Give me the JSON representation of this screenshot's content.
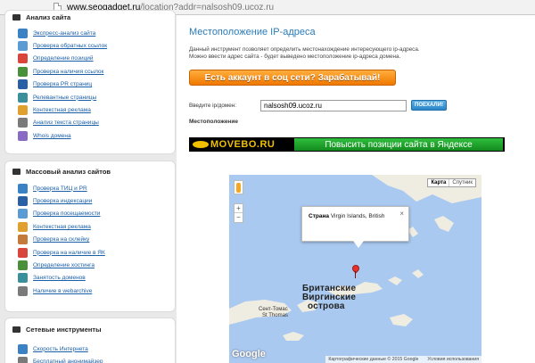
{
  "browser": {
    "url_host": "www.seogadget.ru",
    "url_path": "/location?addr=nalsosh09.ucoz.ru"
  },
  "sidebar": {
    "box1": {
      "title": "Анализ сайта",
      "items": [
        {
          "label": "Экспресс-анализ сайта",
          "icon": "globe-icon",
          "color": "#3b82c4"
        },
        {
          "label": "Проверка обратных ссылок",
          "icon": "links-icon",
          "color": "#5a9bd4"
        },
        {
          "label": "Определение позиций",
          "icon": "positions-icon",
          "color": "#d9443b"
        },
        {
          "label": "Проверка наличия ссылок",
          "icon": "check-links-icon",
          "color": "#4a8f3a"
        },
        {
          "label": "Проверка PR страниц",
          "icon": "pr-icon",
          "color": "#2b5fa3"
        },
        {
          "label": "Релевантные страницы",
          "icon": "relevant-icon",
          "color": "#3b8f9a"
        },
        {
          "label": "Контекстная реклама",
          "icon": "ads-icon",
          "color": "#e0a030"
        },
        {
          "label": "Анализ текста страницы",
          "icon": "text-icon",
          "color": "#7a7a7a"
        },
        {
          "label": "Whois домена",
          "icon": "whois-icon",
          "color": "#8a6bc4"
        }
      ]
    },
    "box2": {
      "title": "Массовый анализ сайтов",
      "items": [
        {
          "label": "Проверка ТИЦ и PR",
          "icon": "tic-pr-icon",
          "color": "#3b82c4"
        },
        {
          "label": "Проверка индексации",
          "icon": "index-icon",
          "color": "#2b5fa3"
        },
        {
          "label": "Проверка посещаемости",
          "icon": "traffic-icon",
          "color": "#5a9bd4"
        },
        {
          "label": "Контекстная реклама",
          "icon": "ads-icon",
          "color": "#e0a030"
        },
        {
          "label": "Проверка на склейку",
          "icon": "glue-icon",
          "color": "#c47a3b"
        },
        {
          "label": "Проверка на наличие в ЯК",
          "icon": "yandex-icon",
          "color": "#d9443b"
        },
        {
          "label": "Определение хостинга",
          "icon": "hosting-icon",
          "color": "#4a8f3a"
        },
        {
          "label": "Занятость доменов",
          "icon": "domains-icon",
          "color": "#3b8f9a"
        },
        {
          "label": "Наличие в webarchive",
          "icon": "archive-icon",
          "color": "#7a7a7a"
        }
      ]
    },
    "box3": {
      "title": "Сетевые инструменты",
      "items": [
        {
          "label": "Скорость Интернета",
          "icon": "speed-icon",
          "color": "#3b82c4"
        },
        {
          "label": "Бесплатный анонимайзер",
          "icon": "anonymizer-icon",
          "color": "#7a7a7a"
        }
      ]
    }
  },
  "main": {
    "title": "Местоположение IP-адреса",
    "desc1": "Данный инструмент позволяет определить местонахождение интересующего ip-адреса.",
    "desc2": "Можно ввести адрес сайта - будет выведено местоположение ip-адреса домена.",
    "promo": "Есть аккаунт в соц сети? Зарабатывай!",
    "ip_label": "Введите ip/домен:",
    "ip_value": "nalsosh09.ucoz.ru",
    "go_button": "ПОЕХАЛИ!",
    "location_label": "Местоположение",
    "banner_logo": "MOVEBO.RU",
    "banner_slogan": "Повысить позиции сайта в Яндексе"
  },
  "map": {
    "type_map": "Карта",
    "type_sat": "Спутник",
    "zoom_in": "+",
    "zoom_out": "−",
    "info_key": "Страна",
    "info_value": "Virgin Islands, British",
    "close": "×",
    "label_line1": "Британские",
    "label_line2": "Виргинские",
    "label_line3": "острова",
    "small_line1": "Сент-Томас",
    "small_line2": "St Thomas",
    "google": "Google",
    "attrib_data": "Картографические данные © 2015 Google",
    "attrib_terms": "Условия использования",
    "water_color": "#a9c9f0",
    "land_color": "#efece2"
  }
}
